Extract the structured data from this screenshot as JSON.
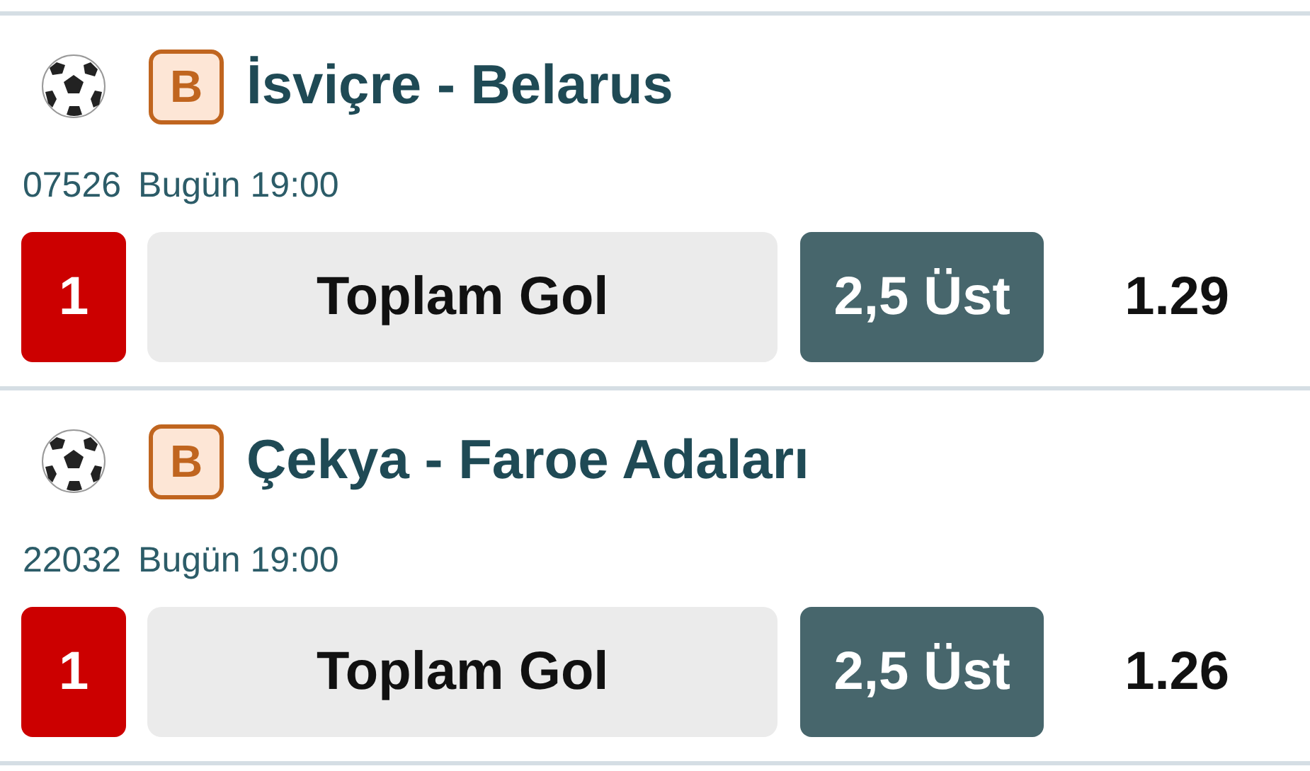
{
  "matches": [
    {
      "badge": "B",
      "title": "İsviçre - Belarus",
      "code": "07526",
      "time": "Bugün 19:00",
      "pick": "1",
      "market": "Toplam Gol",
      "selection": "2,5 Üst",
      "odds": "1.29"
    },
    {
      "badge": "B",
      "title": "Çekya - Faroe Adaları",
      "code": "22032",
      "time": "Bugün 19:00",
      "pick": "1",
      "market": "Toplam Gol",
      "selection": "2,5 Üst",
      "odds": "1.26"
    }
  ]
}
